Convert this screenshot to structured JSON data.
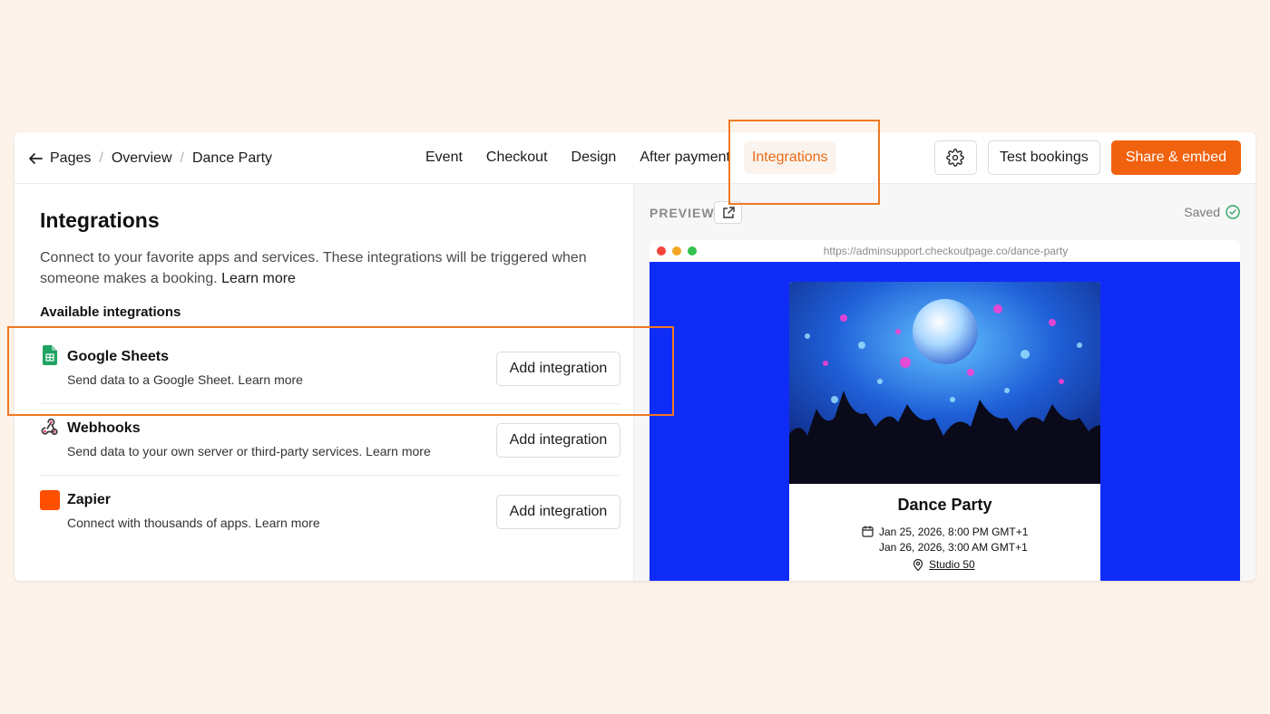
{
  "breadcrumb": {
    "items": [
      "Pages",
      "Overview",
      "Dance Party"
    ],
    "separator": "/"
  },
  "tabs": [
    "Event",
    "Checkout",
    "Design",
    "After payment",
    "Integrations"
  ],
  "active_tab": "Integrations",
  "actions": {
    "test_bookings": "Test bookings",
    "share_embed": "Share & embed",
    "settings_icon": "gear-icon"
  },
  "integrations_page": {
    "title": "Integrations",
    "description": "Connect to your favorite apps and services. These integrations will be triggered when someone makes a booking.",
    "learn_more": "Learn more",
    "available_heading": "Available integrations",
    "items": [
      {
        "name": "Google Sheets",
        "description": "Send data to a Google Sheet.",
        "learn_more": "Learn more",
        "button": "Add integration",
        "icon": "google-sheets-icon"
      },
      {
        "name": "Webhooks",
        "description": "Send data to your own server or third-party services.",
        "learn_more": "Learn more",
        "button": "Add integration",
        "icon": "webhooks-icon"
      },
      {
        "name": "Zapier",
        "description": "Connect with thousands of apps.",
        "learn_more": "Learn more",
        "button": "Add integration",
        "icon": "zapier-icon"
      }
    ]
  },
  "preview": {
    "label": "PREVIEW",
    "status": "Saved",
    "url": "https://adminsupport.checkoutpage.co/dance-party",
    "event": {
      "title": "Dance Party",
      "date_line_1": "Jan 25, 2026, 8:00 PM GMT+1",
      "date_line_2": "Jan 26, 2026, 3:00 AM GMT+1",
      "location": "Studio 50"
    }
  },
  "colors": {
    "accent": "#f1620f",
    "highlight": "#f07820",
    "preview_bg": "#0f2cf6",
    "page_bg": "#fdf3ea"
  }
}
